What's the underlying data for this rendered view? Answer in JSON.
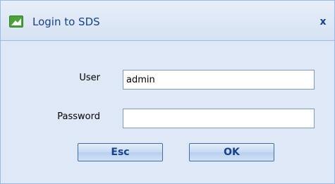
{
  "window": {
    "title": "Login to SDS",
    "close_label": "x"
  },
  "form": {
    "user_label": "User",
    "user_value": "admin",
    "password_label": "Password",
    "password_value": ""
  },
  "buttons": {
    "esc_label": "Esc",
    "ok_label": "OK"
  },
  "icons": {
    "app": "app-logo-icon",
    "close": "close-icon"
  },
  "colors": {
    "title_text": "#15428b",
    "window_bg": "#dfe8f6",
    "border": "#99bbe8",
    "app_icon_green": "#3a8a2a"
  }
}
